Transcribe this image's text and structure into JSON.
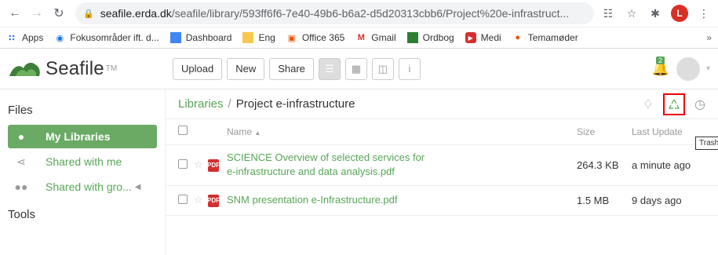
{
  "browser": {
    "url_host": "seafile.erda.dk",
    "url_path": "/seafile/library/593ff6f6-7e40-49b6-b6a2-d5d20313cbb6/Project%20e-infrastruct...",
    "profile_letter": "L"
  },
  "bookmarks": [
    {
      "label": "Apps",
      "icon": "apps-grid-icon",
      "color": "#1a73e8"
    },
    {
      "label": "Fokusområder ift. d...",
      "icon": "target-icon",
      "color": "#1a73e8"
    },
    {
      "label": "Dashboard",
      "icon": "dashboard-icon",
      "color": "#4285f4"
    },
    {
      "label": "Eng",
      "icon": "folder-icon",
      "color": "#f9c74f"
    },
    {
      "label": "Office 365",
      "icon": "office-icon",
      "color": "#e8590c"
    },
    {
      "label": "Gmail",
      "icon": "gmail-icon",
      "color": "#d93025"
    },
    {
      "label": "Ordbog",
      "icon": "book-icon",
      "color": "#2e7d32"
    },
    {
      "label": "Medi",
      "icon": "youtube-icon",
      "color": "#d32f2f"
    },
    {
      "label": "Temamøder",
      "icon": "pin-icon",
      "color": "#e65100"
    }
  ],
  "header": {
    "logo_text": "Seafile",
    "logo_tm": "TM",
    "upload_label": "Upload",
    "new_label": "New",
    "share_label": "Share",
    "notification_count": "2"
  },
  "sidebar": {
    "files_heading": "Files",
    "items": [
      {
        "label": "My Libraries",
        "active": true
      },
      {
        "label": "Shared with me",
        "active": false
      },
      {
        "label": "Shared with gro...",
        "active": false
      }
    ],
    "tools_heading": "Tools"
  },
  "breadcrumb": {
    "libraries": "Libraries",
    "separator": "/",
    "current": "Project e-infrastructure"
  },
  "tooltip": "Trash",
  "table": {
    "columns": {
      "name": "Name",
      "size": "Size",
      "updated": "Last Update"
    },
    "rows": [
      {
        "name": "SCIENCE Overview of selected services for e-infrastructure and data analysis.pdf",
        "name_line1": "SCIENCE Overview of selected services for",
        "name_line2": "e-infrastructure and data analysis.pdf",
        "size": "264.3 KB",
        "updated": "a minute ago"
      },
      {
        "name": "SNM presentation e-Infrastructure.pdf",
        "size": "1.5 MB",
        "updated": "9 days ago"
      }
    ]
  },
  "colors": {
    "accent": "#57a557",
    "active_bg": "#6aaa64",
    "highlight": "#e00000"
  }
}
